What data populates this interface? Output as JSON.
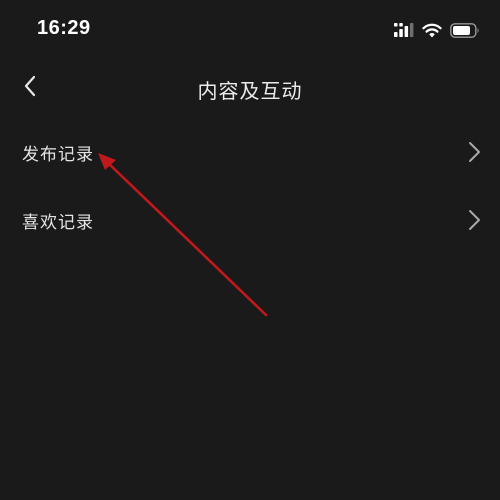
{
  "status_bar": {
    "time": "16:29"
  },
  "nav": {
    "title": "内容及互动"
  },
  "menu": {
    "items": [
      {
        "label": "发布记录",
        "icon": "chevron-right-icon"
      },
      {
        "label": "喜欢记录",
        "icon": "chevron-right-icon"
      }
    ]
  },
  "colors": {
    "background": "#1a1a1a",
    "text": "#e4e4e4",
    "annotation": "#c0191b"
  }
}
